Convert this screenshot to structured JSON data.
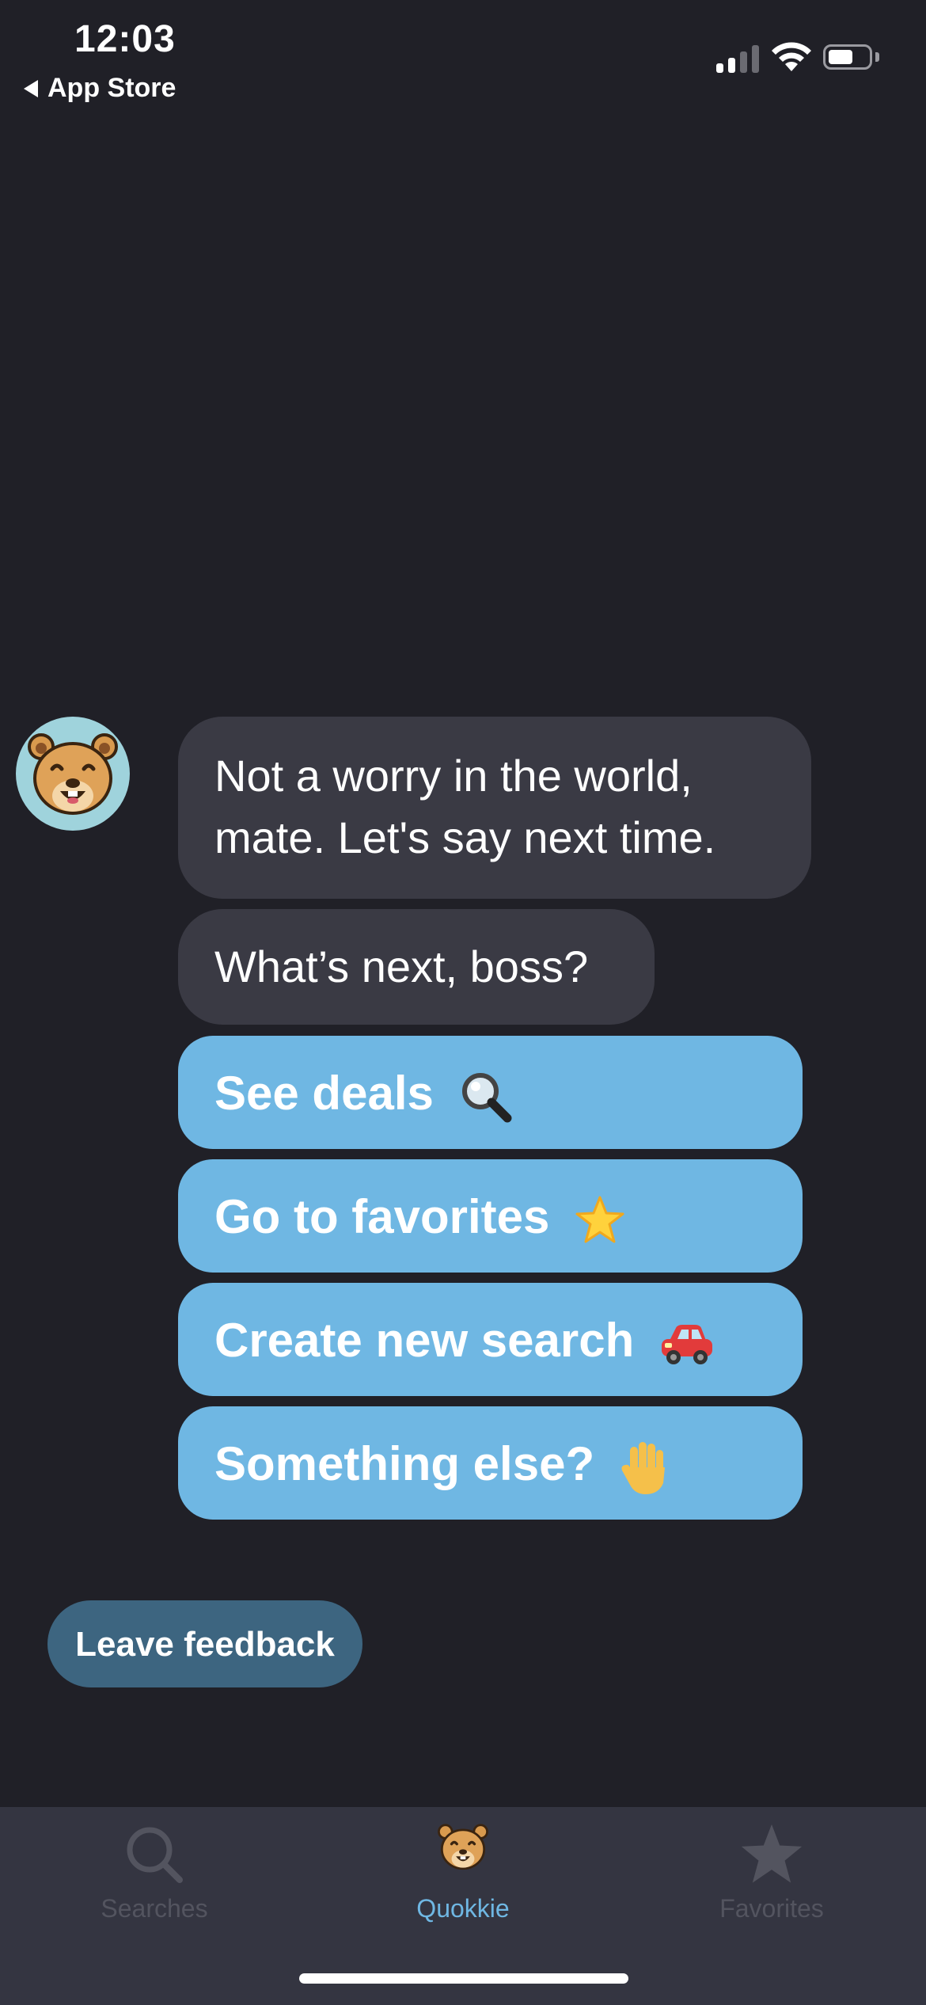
{
  "status_bar": {
    "time": "12:03",
    "back_label": "App Store"
  },
  "chat": {
    "avatar_icon": "quokka-face-icon",
    "messages": [
      {
        "lines": [
          "Not a worry in the world,",
          "mate. Let's say next time."
        ]
      },
      {
        "lines": [
          "What’s next, boss?"
        ]
      }
    ],
    "options": [
      {
        "label": "See deals",
        "emoji": "magnifying-glass-icon"
      },
      {
        "label": "Go to favorites",
        "emoji": "star-icon"
      },
      {
        "label": "Create new search",
        "emoji": "red-car-icon"
      },
      {
        "label": "Something else?",
        "emoji": "raised-hand-icon"
      }
    ],
    "feedback_label": "Leave feedback"
  },
  "tab_bar": {
    "tabs": [
      {
        "label": "Searches",
        "icon": "search-icon",
        "active": false
      },
      {
        "label": "Quokkie",
        "icon": "quokka-face-icon",
        "active": true
      },
      {
        "label": "Favorites",
        "icon": "star-icon",
        "active": false
      }
    ]
  },
  "colors": {
    "background": "#202027",
    "bubble": "#3a3a44",
    "option_button": "#6fb7e3",
    "feedback_button": "#3d6580",
    "tab_bar": "#343541",
    "tab_active": "#6fb7e3",
    "tab_inactive": "#53545f"
  }
}
